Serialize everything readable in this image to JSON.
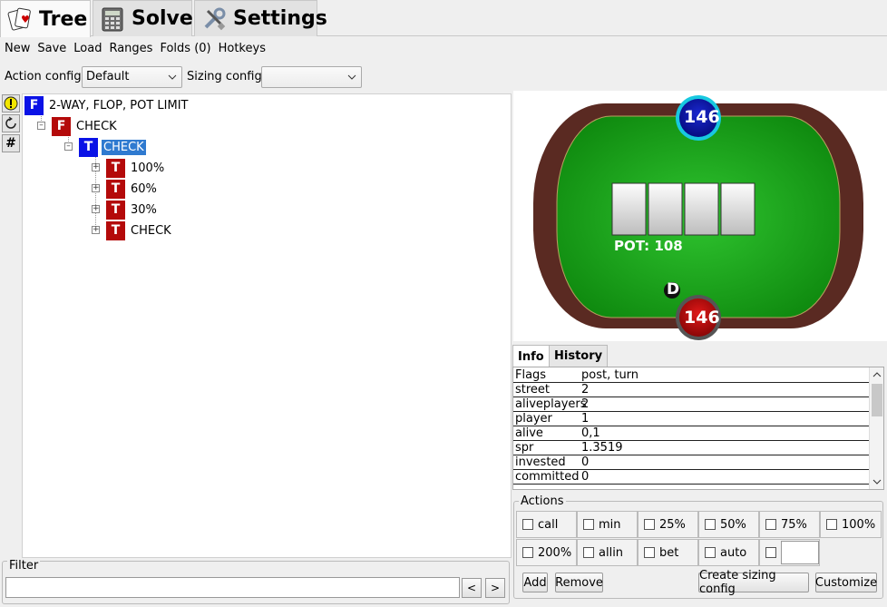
{
  "tabs": [
    {
      "label": "Tree",
      "icon": "cards-icon",
      "active": true
    },
    {
      "label": "Solve",
      "icon": "calculator-icon",
      "active": false
    },
    {
      "label": "Settings",
      "icon": "tools-icon",
      "active": false
    }
  ],
  "menu": [
    "New",
    "Save",
    "Load",
    "Ranges",
    "Folds (0)",
    "Hotkeys"
  ],
  "config": {
    "action_label": "Action config:",
    "action_value": "Default",
    "sizing_label": "Sizing config:",
    "sizing_value": ""
  },
  "side_icons": [
    "warning-icon",
    "refresh-icon",
    "hash-icon"
  ],
  "tree": {
    "root": {
      "badge": "F",
      "label": "2-WAY, FLOP, POT LIMIT"
    },
    "n1": {
      "badge": "F",
      "label": "CHECK"
    },
    "n2": {
      "badge": "T",
      "label": "CHECK"
    },
    "children": [
      {
        "badge": "T",
        "label": "100%"
      },
      {
        "badge": "T",
        "label": "60%"
      },
      {
        "badge": "T",
        "label": "30%"
      },
      {
        "badge": "T",
        "label": "CHECK"
      }
    ]
  },
  "filter": {
    "label": "Filter",
    "value": "",
    "prev": "<",
    "next": ">"
  },
  "table": {
    "top_stack": "146",
    "bottom_stack": "146",
    "dealer": "D",
    "pot": "POT: 108",
    "colors": {
      "felt": "#1fa81f",
      "rail": "#5a2a22",
      "top_seat": "#0a12a8",
      "bottom_seat": "#c01010"
    }
  },
  "info_tabs": [
    {
      "label": "Info",
      "active": true
    },
    {
      "label": "History",
      "active": false
    }
  ],
  "info_rows": [
    {
      "k": "Flags",
      "v": "post, turn"
    },
    {
      "k": "street",
      "v": "2"
    },
    {
      "k": "aliveplayers",
      "v": "2"
    },
    {
      "k": "player",
      "v": "1"
    },
    {
      "k": "alive",
      "v": "0,1"
    },
    {
      "k": "spr",
      "v": "1.3519"
    },
    {
      "k": "invested",
      "v": "0"
    },
    {
      "k": "committed",
      "v": "0"
    }
  ],
  "actions": {
    "label": "Actions",
    "row1": [
      "call",
      "min",
      "25%",
      "50%",
      "75%",
      "100%"
    ],
    "row2": [
      "200%",
      "allin",
      "bet",
      "auto"
    ],
    "custom_value": "",
    "add": "Add",
    "remove": "Remove",
    "create": "Create sizing config",
    "customize": "Customize"
  }
}
